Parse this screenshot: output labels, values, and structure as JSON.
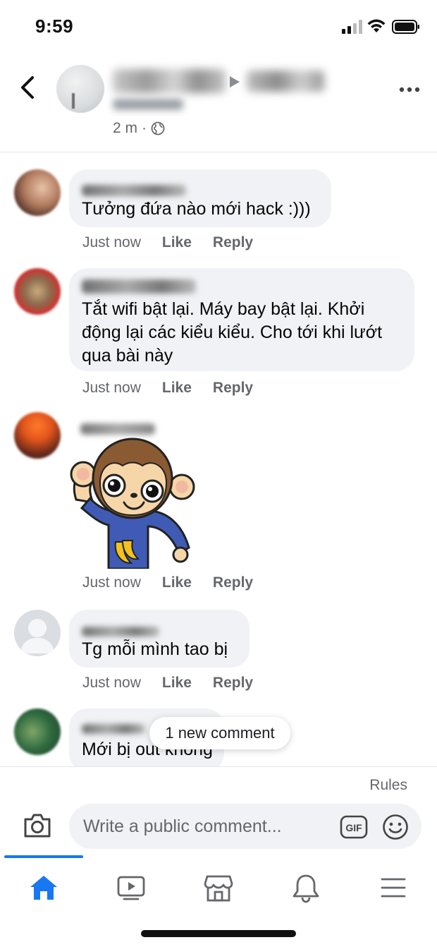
{
  "status_bar": {
    "time": "9:59"
  },
  "post_header": {
    "meta_time": "2 m",
    "meta_sep": "·"
  },
  "comments": [
    {
      "text": "Tưởng đứa nào mới hack :)))",
      "time": "Just now",
      "like": "Like",
      "reply": "Reply"
    },
    {
      "text": "Tắt wifi bật lại. Máy bay bật lại. Khởi động lại các kiểu kiểu. Cho tới khi lướt qua bài này",
      "time": "Just now",
      "like": "Like",
      "reply": "Reply"
    },
    {
      "text": "",
      "time": "Just now",
      "like": "Like",
      "reply": "Reply"
    },
    {
      "text": "Tg mỗi mình tao bị",
      "time": "Just now",
      "like": "Like",
      "reply": "Reply"
    },
    {
      "text": "Mới bị out không"
    }
  ],
  "toast": {
    "label": "1 new comment"
  },
  "composer": {
    "rules_label": "Rules",
    "placeholder": "Write a public comment...",
    "gif_label": "GIF"
  },
  "nav": {
    "items": [
      "home-icon",
      "watch-icon",
      "marketplace-icon",
      "notifications-icon",
      "menu-icon"
    ],
    "active_color": "#1877f2",
    "icon_color": "#65676b"
  }
}
